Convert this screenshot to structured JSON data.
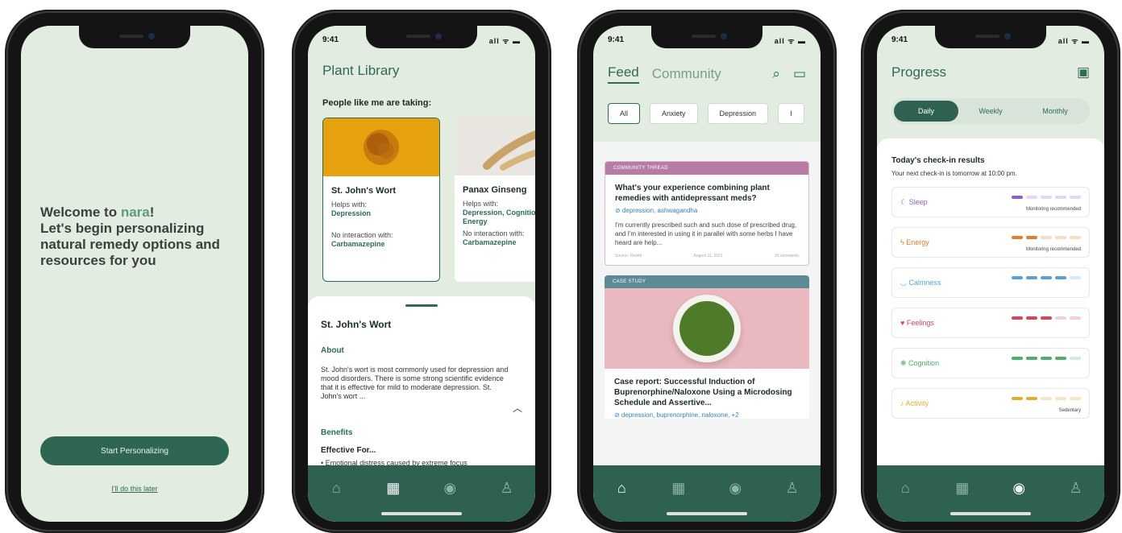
{
  "colors": {
    "brand_green": "#2f6a55",
    "tab_bar": "#2e6151",
    "screen_bg": "#e3ece0"
  },
  "status": {
    "time": "9:41",
    "signal": "all ᯤ ▬"
  },
  "welcome_screen": {
    "intro": "Welcome to ",
    "brand": "nara",
    "intro_end": "!",
    "line2": "Let's begin personalizing natural remedy options and resources for you",
    "start_button": "Start Personalizing",
    "later_link": "I'll do this later"
  },
  "library_screen": {
    "title": "Plant Library",
    "subtitle": "People like me are taking:",
    "cards": [
      {
        "name": "St. John's Wort",
        "helps_label": "Helps with:",
        "helps": "Depression",
        "no_interaction_label": "No interaction with:",
        "no_interaction": "Carbamazepine",
        "image": "st-johns-wort-image"
      },
      {
        "name": "Panax Ginseng",
        "helps_label": "Helps with:",
        "helps": "Depression, Cognition, Energy",
        "no_interaction_label": "No interaction with:",
        "no_interaction": "Carbamazepine",
        "image": "ginseng-root-image"
      }
    ],
    "detail": {
      "title": "St. John's Wort",
      "about_label": "About",
      "about_text": "St. John's wort is most commonly used for depression and mood disorders. There is some strong scientific evidence that it is effective for mild to moderate depression. St. John's wort ...",
      "benefits_label": "Benefits",
      "effective_for": "Effective For...",
      "bullet": "• Emotional distress caused by extreme focus"
    }
  },
  "feed_screen": {
    "tabs": [
      "Feed",
      "Community"
    ],
    "active_tab": "Feed",
    "chips": [
      "All",
      "Anxiety",
      "Depression",
      "I"
    ],
    "thread": {
      "tag": "COMMUNITY THREAD",
      "title": "What's your experience combining plant remedies with antidepressant meds?",
      "tags": "⊘ depression, ashwagandha",
      "body": "I'm currently prescribed such and such dose of prescribed drug, and I'm interested in using it in parallel with some herbs I have heard are help...",
      "source": "Source: Reddit",
      "date": "August 11, 2021",
      "comments": "15 comments"
    },
    "case": {
      "tag": "CASE STUDY",
      "title": "Case report: Successful Induction of Buprenorphine/Naloxone Using a Microdosing Schedule and Assertive...",
      "tags": "⊘ depression, buprenorphine, naloxone, +2"
    }
  },
  "progress_screen": {
    "title": "Progress",
    "segments": [
      "Daily",
      "Weekly",
      "Monthly"
    ],
    "active_segment": "Daily",
    "heading": "Today's check-in results",
    "subheading": "Your next check-in is tomorrow at 10:00 pm.",
    "metrics": [
      {
        "name": "Sleep",
        "icon": "moon-icon",
        "color": "#8b5fd0",
        "light": "#e2d8f3",
        "level": 1,
        "note": "Monitoring recommended"
      },
      {
        "name": "Energy",
        "icon": "bolt-icon",
        "color": "#e27c2e",
        "light": "#f7dcc6",
        "level": 2,
        "note": "Monitoring recommended"
      },
      {
        "name": "Calmness",
        "icon": "cup-icon",
        "color": "#5aa0d8",
        "light": "#d6e8f6",
        "level": 4,
        "note": ""
      },
      {
        "name": "Feelings",
        "icon": "heart-icon",
        "color": "#d6455a",
        "light": "#f4d0d6",
        "level": 3,
        "note": ""
      },
      {
        "name": "Cognition",
        "icon": "brain-icon",
        "color": "#4fae6a",
        "light": "#d2ecd8",
        "level": 4,
        "note": ""
      },
      {
        "name": "Activity",
        "icon": "run-icon",
        "color": "#e6ae2e",
        "light": "#f6e7c4",
        "level": 2,
        "note": "Sedentary"
      }
    ]
  }
}
